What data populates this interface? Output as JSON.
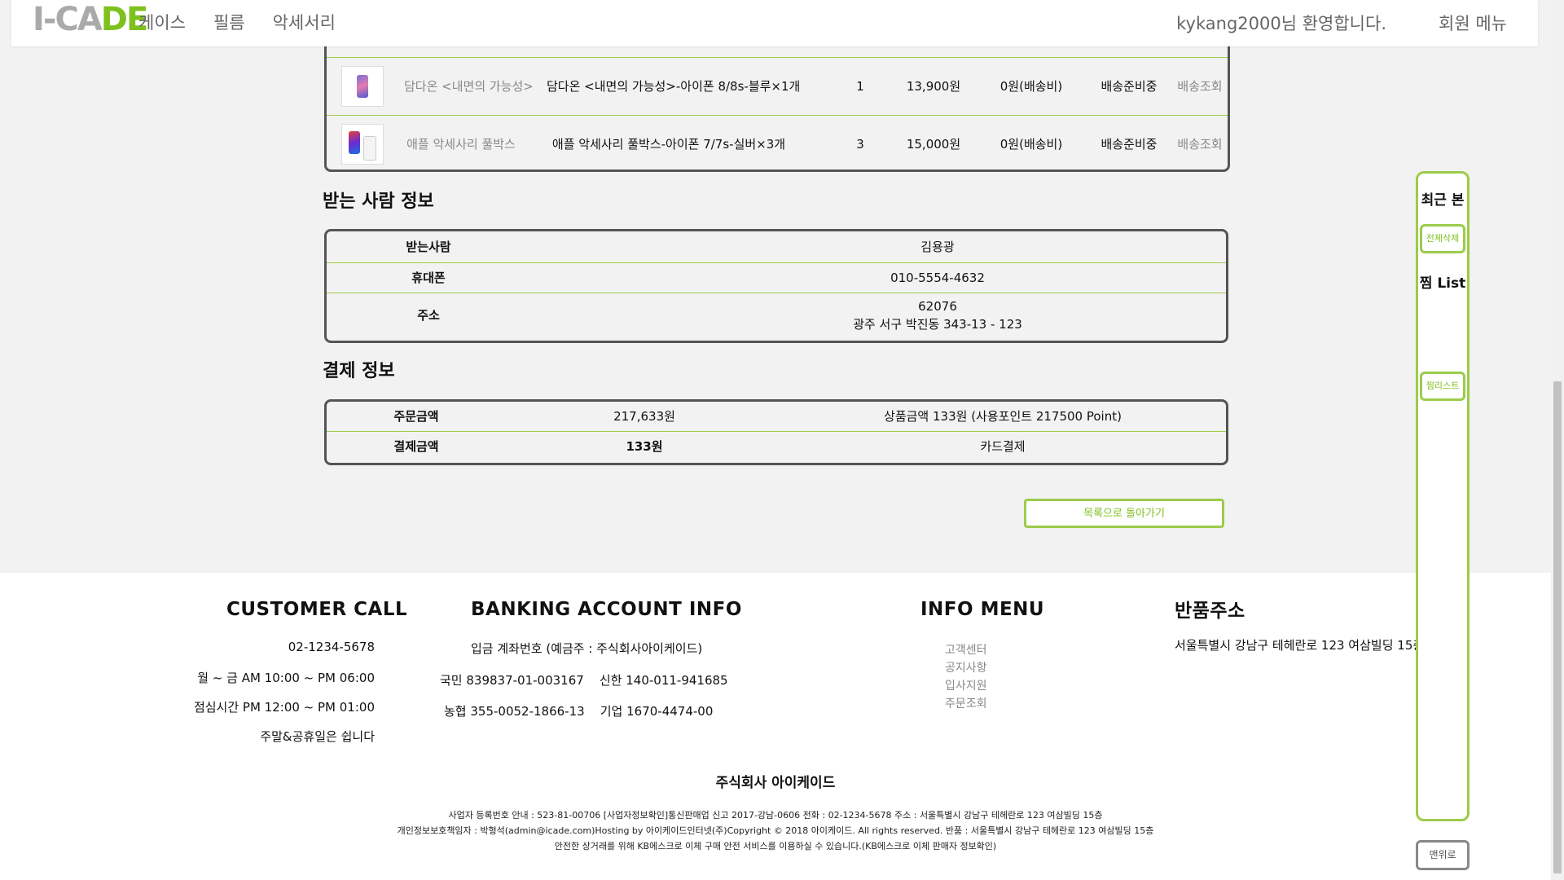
{
  "header": {
    "logo_part1": "I-",
    "logo_part2": "CA",
    "logo_part3": "DE",
    "nav": [
      "케이스",
      "필름",
      "악세서리"
    ],
    "welcome": "kykang2000님 환영합니다.",
    "member_menu": "회원 메뉴"
  },
  "order_items": [
    {
      "name": "담다온 <내면의 가능성>",
      "option": "담다온 <내면의 가능성>-아이폰 8/8s-블루×1개",
      "qty": "1",
      "price": "13,900원",
      "shipping": "0원(배송비)",
      "status": "배송준비중",
      "track": "배송조회"
    },
    {
      "name": "애플 악세사리 풀박스",
      "option": "애플 악세사리 풀박스-아이폰 7/7s-실버×3개",
      "qty": "3",
      "price": "15,000원",
      "shipping": "0원(배송비)",
      "status": "배송준비중",
      "track": "배송조회"
    }
  ],
  "recipient": {
    "title": "받는 사람 정보",
    "name_label": "받는사람",
    "name": "김용광",
    "phone_label": "휴대폰",
    "phone": "010-5554-4632",
    "address_label": "주소",
    "zip": "62076",
    "address": "광주 서구 박진동 343-13 - 123"
  },
  "payment": {
    "title": "결제 정보",
    "order_amount_label": "주문금액",
    "order_amount": "217,633원",
    "order_detail": "상품금액 133원 (사용포인트 217500 Point)",
    "paid_label": "결제금액",
    "paid": "133원",
    "method": "카드결제"
  },
  "back_button": "목록으로 돌아가기",
  "side": {
    "recent": "최근 본",
    "clear_all": "전체삭제",
    "wishlist_title": "찜 List",
    "wishlist_btn": "찜리스트",
    "top_btn": "맨위로"
  },
  "footer": {
    "call_title": "CUSTOMER CALL",
    "call_lines": [
      "02-1234-5678",
      "월 ~ 금 AM 10:00 ~ PM 06:00",
      "점심시간 PM 12:00 ~ PM 01:00",
      "주말&공휴일은 쉽니다"
    ],
    "bank_title": "BANKING ACCOUNT INFO",
    "bank_lines": [
      "입금 계좌번호 (예금주 : 주식회사아이케이드)",
      "국민 839837-01-003167    신한 140-011-941685",
      "농협 355-0052-1866-13    기업 1670-4474-00"
    ],
    "menu_title": "INFO MENU",
    "menu_items": [
      "고객센터",
      "공지사항",
      "입사지원",
      "주문조회"
    ],
    "return_title": "반품주소",
    "return_address": "서울특별시 강남구 테헤란로 123 여삼빌딩 15층",
    "company": "주식회사 아이케이드",
    "legal": [
      "사업자 등록번호 안내 : 523-81-00706 [사업자정보확인]통신판매업 신고 2017-강남-0606 전화 : 02-1234-5678 주소 : 서울특별시 강남구 테헤란로 123 여삼빌딩 15층",
      "개인정보보호책임자 : 박형석(admin@icade.com)Hosting by 아이케이드인터넷(주)Copyright © 2018 아이케이드. All rights reserved. 반품 : 서울특별시 강남구 테헤란로 123 여삼빌딩 15층",
      "안전한 상거래를 위해 KB에스크로 이체 구매 안전 서비스를 이용하실 수 있습니다.(KB에스크로 이체 판매자 정보확인)"
    ]
  },
  "colors": {
    "accent": "#7ec11f",
    "border": "#555555",
    "divider": "#9ccc4a"
  }
}
